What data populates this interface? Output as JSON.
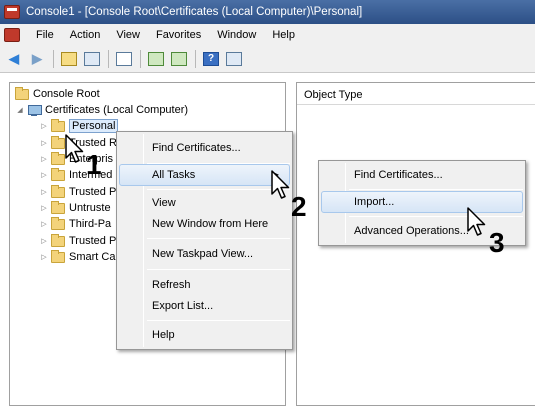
{
  "window": {
    "title": "Console1 - [Console Root\\Certificates (Local Computer)\\Personal]"
  },
  "menubar": {
    "items": [
      "File",
      "Action",
      "View",
      "Favorites",
      "Window",
      "Help"
    ]
  },
  "right_pane": {
    "column_header": "Object Type"
  },
  "tree": {
    "root": "Console Root",
    "certificates": "Certificates (Local Computer)",
    "items": [
      "Personal",
      "Trusted R",
      "Enterpris",
      "Intermed",
      "Trusted P",
      "Untruste",
      "Third-Pa",
      "Trusted P",
      "Smart Ca"
    ]
  },
  "context_menu": {
    "items": [
      "Find Certificates...",
      "All Tasks",
      "View",
      "New Window from Here",
      "New Taskpad View...",
      "Refresh",
      "Export List...",
      "Help"
    ],
    "submenu_arrow": "▶"
  },
  "submenu": {
    "items": [
      "Find Certificates...",
      "Import...",
      "Advanced Operations..."
    ]
  },
  "steps": [
    "1",
    "2",
    "3"
  ],
  "icons": {
    "toolbar": [
      "back-arrow-icon",
      "forward-arrow-icon",
      "up-folder-icon",
      "show-hide-tree-icon",
      "properties-icon",
      "refresh-icon",
      "export-icon",
      "help-icon",
      "console-icon"
    ]
  },
  "colors": {
    "title_bar": "#2c4f86",
    "highlight": "#d6e5f6",
    "folder": "#f3d37a"
  }
}
